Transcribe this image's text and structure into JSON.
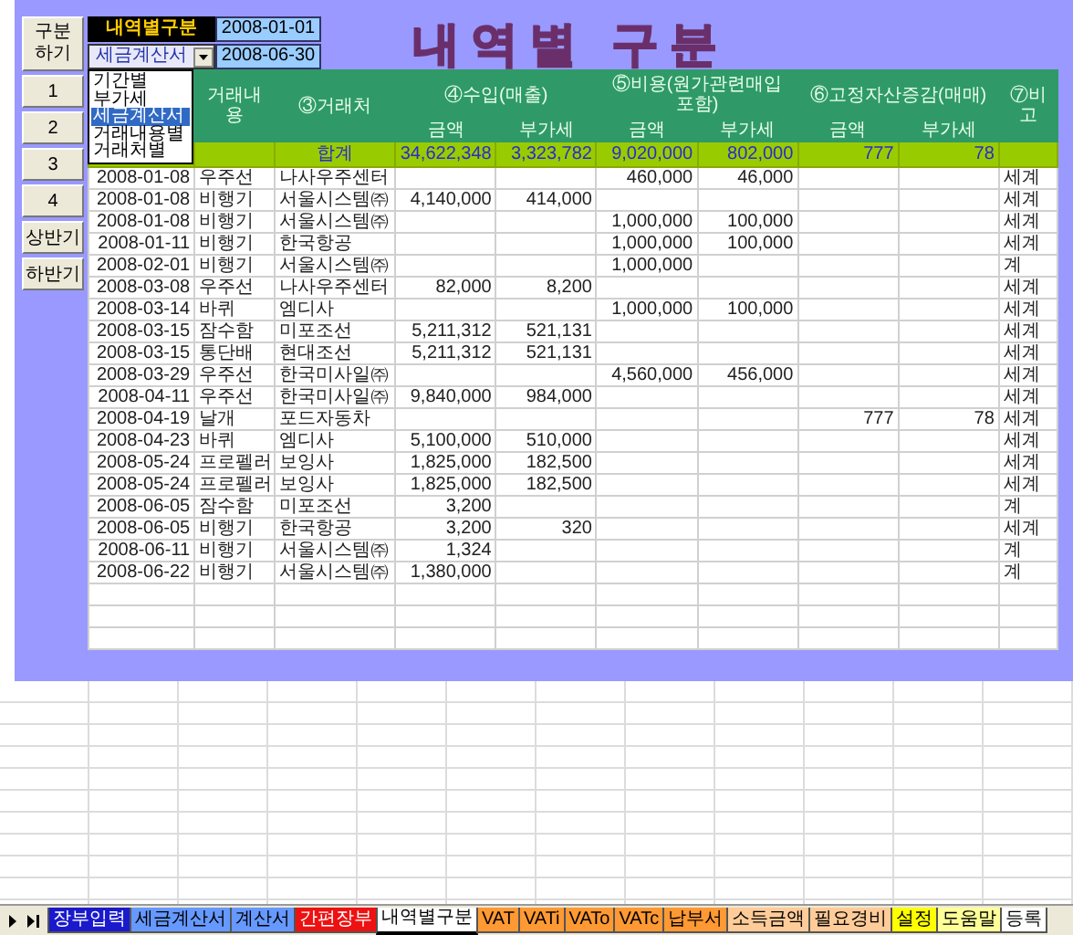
{
  "side_buttons": [
    "구분하기",
    "1",
    "2",
    "3",
    "4",
    "상반기",
    "하반기"
  ],
  "controls": {
    "label": "내역별구분",
    "start_date": "2008-01-01",
    "type_value": "세금계산서",
    "end_date": "2008-06-30",
    "type_options": [
      {
        "label": "기간별",
        "selected": false
      },
      {
        "label": "부가세",
        "selected": false
      },
      {
        "label": "세금계산서",
        "selected": true
      },
      {
        "label": "거래내용별",
        "selected": false
      },
      {
        "label": "거래처별",
        "selected": false
      }
    ]
  },
  "title": "내역별 구분",
  "table": {
    "header": {
      "item": "거래내용",
      "vendor": "③거래처",
      "groups": [
        {
          "label": "④수입(매출)",
          "amount": "금액",
          "vat": "부가세"
        },
        {
          "label": "⑤비용(원가관련매입 포함)",
          "amount": "금액",
          "vat": "부가세"
        },
        {
          "label": "⑥고정자산증감(매매)",
          "amount": "금액",
          "vat": "부가세"
        }
      ],
      "remark": "⑦비고"
    },
    "total": {
      "label": "합계",
      "values": [
        "34,622,348",
        "3,323,782",
        "9,020,000",
        "802,000",
        "777",
        "78"
      ]
    },
    "rows": [
      {
        "date": "2008-01-08",
        "item": "우주선",
        "vendor": "나사우주센터",
        "cost_amount": "460,000",
        "cost_vat": "46,000",
        "remark": "세계"
      },
      {
        "date": "2008-01-08",
        "item": "비행기",
        "vendor": "서울시스템㈜",
        "income_amount": "4,140,000",
        "income_vat": "414,000",
        "remark": "세계"
      },
      {
        "date": "2008-01-08",
        "item": "비행기",
        "vendor": "서울시스템㈜",
        "cost_amount": "1,000,000",
        "cost_vat": "100,000",
        "remark": "세계"
      },
      {
        "date": "2008-01-11",
        "item": "비행기",
        "vendor": "한국항공",
        "cost_amount": "1,000,000",
        "cost_vat": "100,000",
        "remark": "세계"
      },
      {
        "date": "2008-02-01",
        "item": "비행기",
        "vendor": "서울시스템㈜",
        "cost_amount": "1,000,000",
        "remark": "계"
      },
      {
        "date": "2008-03-08",
        "item": "우주선",
        "vendor": "나사우주센터",
        "income_amount": "82,000",
        "income_vat": "8,200",
        "remark": "세계"
      },
      {
        "date": "2008-03-14",
        "item": "바퀴",
        "vendor": "엠디사",
        "cost_amount": "1,000,000",
        "cost_vat": "100,000",
        "remark": "세계"
      },
      {
        "date": "2008-03-15",
        "item": "잠수함",
        "vendor": "미포조선",
        "income_amount": "5,211,312",
        "income_vat": "521,131",
        "remark": "세계"
      },
      {
        "date": "2008-03-15",
        "item": "통단배",
        "vendor": "현대조선",
        "income_amount": "5,211,312",
        "income_vat": "521,131",
        "remark": "세계"
      },
      {
        "date": "2008-03-29",
        "item": "우주선",
        "vendor": "한국미사일㈜",
        "cost_amount": "4,560,000",
        "cost_vat": "456,000",
        "remark": "세계"
      },
      {
        "date": "2008-04-11",
        "item": "우주선",
        "vendor": "한국미사일㈜",
        "income_amount": "9,840,000",
        "income_vat": "984,000",
        "remark": "세계"
      },
      {
        "date": "2008-04-19",
        "item": "날개",
        "vendor": "포드자동차",
        "asset_amount": "777",
        "asset_vat": "78",
        "remark": "세계"
      },
      {
        "date": "2008-04-23",
        "item": "바퀴",
        "vendor": "엠디사",
        "income_amount": "5,100,000",
        "income_vat": "510,000",
        "remark": "세계"
      },
      {
        "date": "2008-05-24",
        "item": "프로펠러",
        "vendor": "보잉사",
        "income_amount": "1,825,000",
        "income_vat": "182,500",
        "remark": "세계"
      },
      {
        "date": "2008-05-24",
        "item": "프로펠러",
        "vendor": "보잉사",
        "income_amount": "1,825,000",
        "income_vat": "182,500",
        "remark": "세계"
      },
      {
        "date": "2008-06-05",
        "item": "잠수함",
        "vendor": "미포조선",
        "income_amount": "3,200",
        "remark": "계"
      },
      {
        "date": "2008-06-05",
        "item": "비행기",
        "vendor": "한국항공",
        "income_amount": "3,200",
        "income_vat": "320",
        "remark": "세계"
      },
      {
        "date": "2008-06-11",
        "item": "비행기",
        "vendor": "서울시스템㈜",
        "income_amount": "1,324",
        "remark": "계"
      },
      {
        "date": "2008-06-22",
        "item": "비행기",
        "vendor": "서울시스템㈜",
        "income_amount": "1,380,000",
        "remark": "계"
      }
    ]
  },
  "sheet_tabs": [
    {
      "label": "장부입력",
      "color": "#1a1acc",
      "selected": false
    },
    {
      "label": "세금계산서",
      "color": "#6699ff",
      "selected": false
    },
    {
      "label": "계산서",
      "color": "#6699ff",
      "selected": false
    },
    {
      "label": "간편장부",
      "color": "#ee1111",
      "selected": false
    },
    {
      "label": "내역별구분",
      "color": "#ffffff",
      "selected": true
    },
    {
      "label": "VAT",
      "color": "#ff9933",
      "selected": false
    },
    {
      "label": "VATi",
      "color": "#ff9933",
      "selected": false
    },
    {
      "label": "VATo",
      "color": "#ff9933",
      "selected": false
    },
    {
      "label": "VATc",
      "color": "#ff9933",
      "selected": false
    },
    {
      "label": "납부서",
      "color": "#ff9933",
      "selected": false
    },
    {
      "label": "소득금액",
      "color": "#ffcc99",
      "selected": false
    },
    {
      "label": "필요경비",
      "color": "#ffcc99",
      "selected": false
    },
    {
      "label": "설정",
      "color": "#ffff00",
      "selected": false
    },
    {
      "label": "도움말",
      "color": "#ffff99",
      "selected": false
    },
    {
      "label": "등록",
      "color": "#ffffff",
      "selected": false
    }
  ]
}
